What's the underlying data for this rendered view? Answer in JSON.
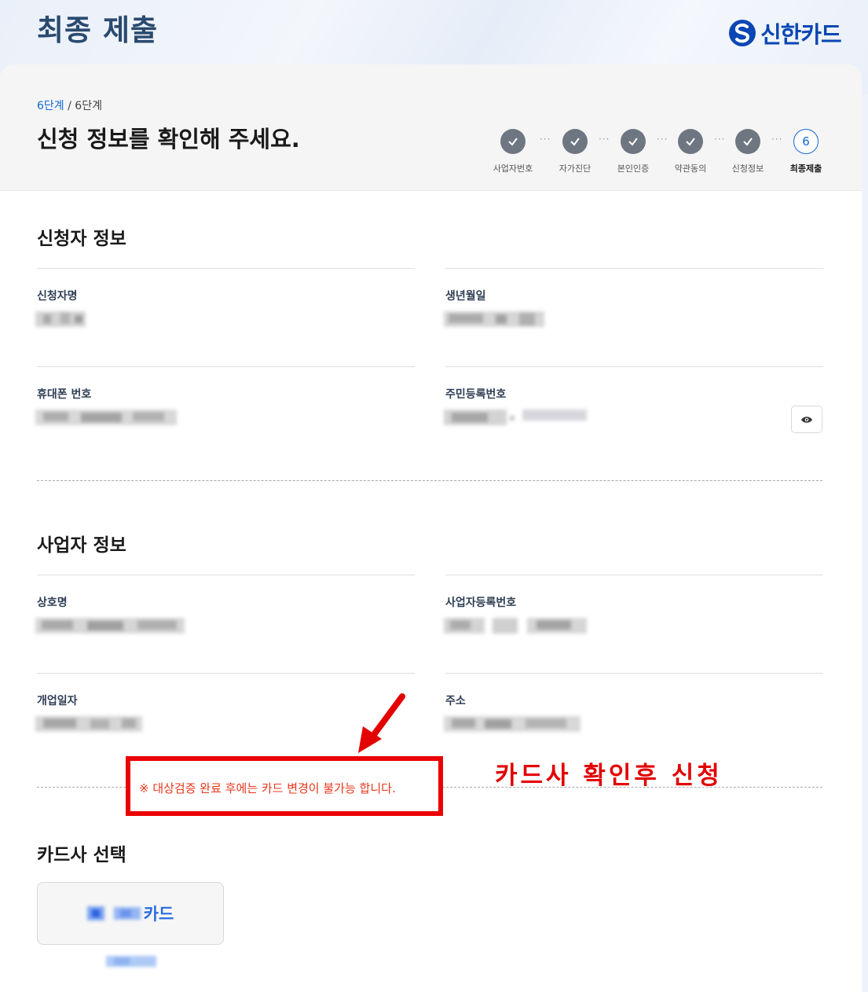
{
  "header": {
    "title": "최종 제출",
    "logo_text": "신한카드",
    "logo_icon": "shinhan-logo-icon"
  },
  "progress": {
    "current_label": "6단계",
    "separator": " / ",
    "total_label": "6단계"
  },
  "heading": "신청 정보를 확인해 주세요.",
  "stepper": {
    "steps": [
      {
        "label": "사업자번호",
        "state": "done"
      },
      {
        "label": "자가진단",
        "state": "done"
      },
      {
        "label": "본인인증",
        "state": "done"
      },
      {
        "label": "약관동의",
        "state": "done"
      },
      {
        "label": "신청정보",
        "state": "done"
      },
      {
        "label": "최종제출",
        "state": "active",
        "number": "6"
      }
    ],
    "separator": "···"
  },
  "applicant": {
    "title": "신청자 정보",
    "name_label": "신청자명",
    "birth_label": "생년월일",
    "phone_label": "휴대폰 번호",
    "rrn_label": "주민등록번호",
    "reveal_icon": "eye-icon"
  },
  "business": {
    "title": "사업자 정보",
    "company_label": "상호명",
    "regno_label": "사업자등록번호",
    "opendate_label": "개업일자",
    "address_label": "주소"
  },
  "card_company": {
    "title": "카드사 선택",
    "notice": "※ 대상검증 완료 후에는 카드 변경이 불가능 합니다.",
    "option_name": "카드"
  },
  "annotation": {
    "text": "카드사 확인후 신청",
    "color": "#e20000"
  },
  "colors": {
    "brand": "#0a46b4",
    "accent": "#1467d6",
    "step_done": "#6e7681",
    "notice": "#e6361a"
  }
}
